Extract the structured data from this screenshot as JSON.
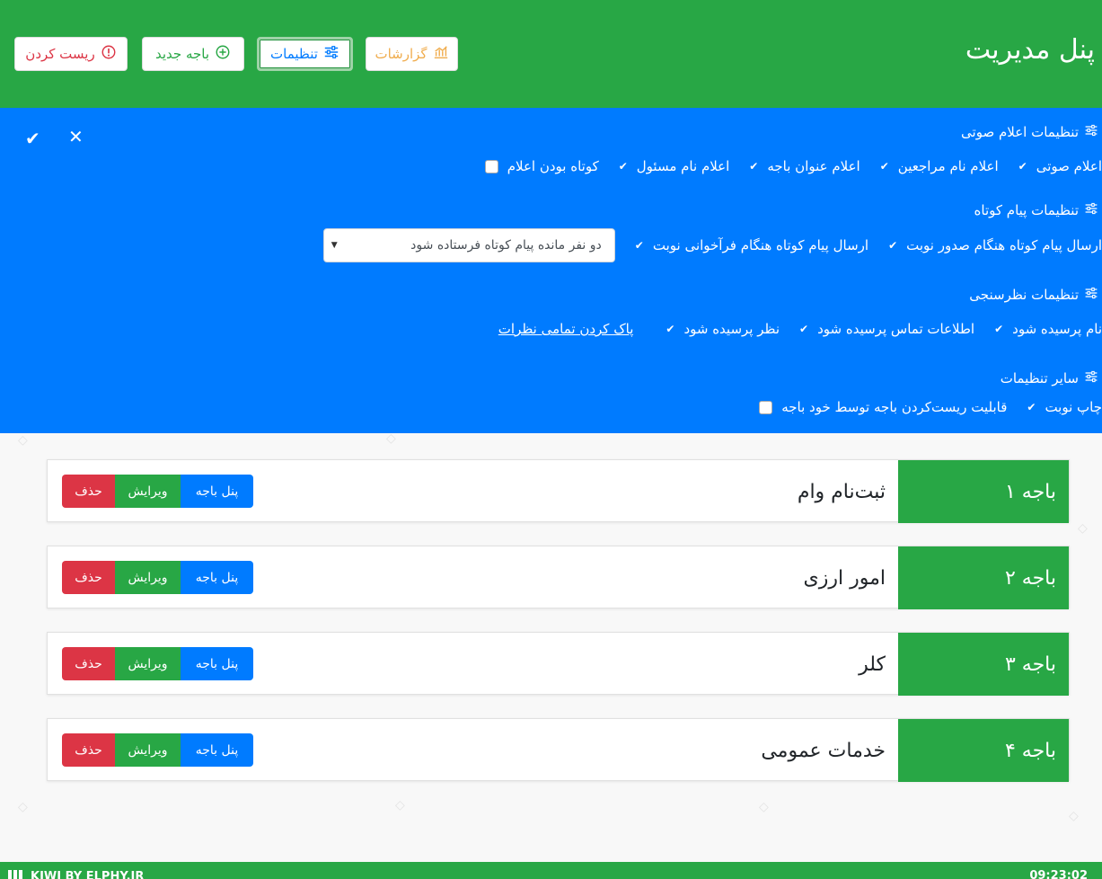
{
  "header": {
    "title": "پنل مدیریت",
    "buttons": {
      "reports": "گزارشات",
      "settings": "تنظیمات",
      "new_counter": "باجه جدید",
      "reset": "ریست کردن"
    },
    "colors": {
      "reports": "#f0ad4e",
      "settings": "#007bff",
      "new_counter": "#28a745",
      "reset": "#dc3545"
    }
  },
  "settings": {
    "voice": {
      "title": "تنظیمات اعلام صوتی",
      "options": [
        "اعلام صوتی",
        "اعلام نام مراجعین",
        "اعلام عنوان باجه",
        "اعلام نام مسئول"
      ],
      "checkbox_label": "کوتاه بودن اعلام"
    },
    "sms": {
      "title": "تنظیمات پیام کوتاه",
      "options": [
        "ارسال پیام کوتاه هنگام صدور نوبت",
        "ارسال پیام کوتاه هنگام فرآخوانی نوبت"
      ],
      "select_value": "دو نفر مانده پیام کوتاه فرستاده شود"
    },
    "survey": {
      "title": "تنظیمات نظرسنجی",
      "options": [
        "نام پرسیده شود",
        "اطلاعات تماس پرسیده شود",
        "نظر پرسیده شود"
      ],
      "clear_link": "پاک کردن تمامی نظرات"
    },
    "other": {
      "title": "سایر تنظیمات",
      "options": [
        "چاپ نوبت"
      ],
      "checkbox_label": "قابلیت ریست‌کردن باجه توسط خود باجه"
    }
  },
  "counters": [
    {
      "number": "باجه ۱",
      "name": "ثبت‌نام وام"
    },
    {
      "number": "باجه ۲",
      "name": "امور ارزی"
    },
    {
      "number": "باجه ۳",
      "name": "کلر"
    },
    {
      "number": "باجه ۴",
      "name": "خدمات عمومی"
    }
  ],
  "counter_actions": {
    "panel": "پنل باجه",
    "edit": "ویرایش",
    "delete": "حذف"
  },
  "footer": {
    "brand": "KIWI BY ELPHY.IR",
    "time": "09:23:02"
  }
}
